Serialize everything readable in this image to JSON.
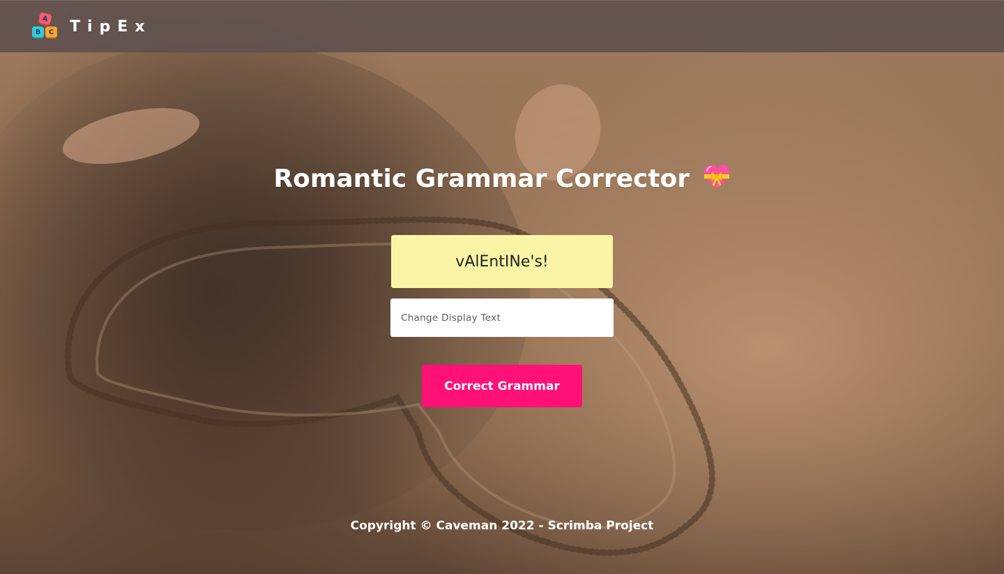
{
  "header": {
    "brand": "TipEx",
    "logo_blocks": [
      "A",
      "B",
      "C"
    ]
  },
  "main": {
    "title": "Romantic Grammar Corrector",
    "title_emoji": "heart-with-ribbon-icon",
    "display_text": "vAlEntINe's!",
    "input": {
      "placeholder": "Change Display Text",
      "value": ""
    },
    "button_label": "Correct Grammar"
  },
  "footer": {
    "copyright": "Copyright © Caveman 2022 - Scrimba Project"
  },
  "colors": {
    "header_bg": "#5f504e",
    "display_bg": "#faf5a6",
    "button_bg": "#ff1178",
    "text_white": "#ffffff"
  }
}
